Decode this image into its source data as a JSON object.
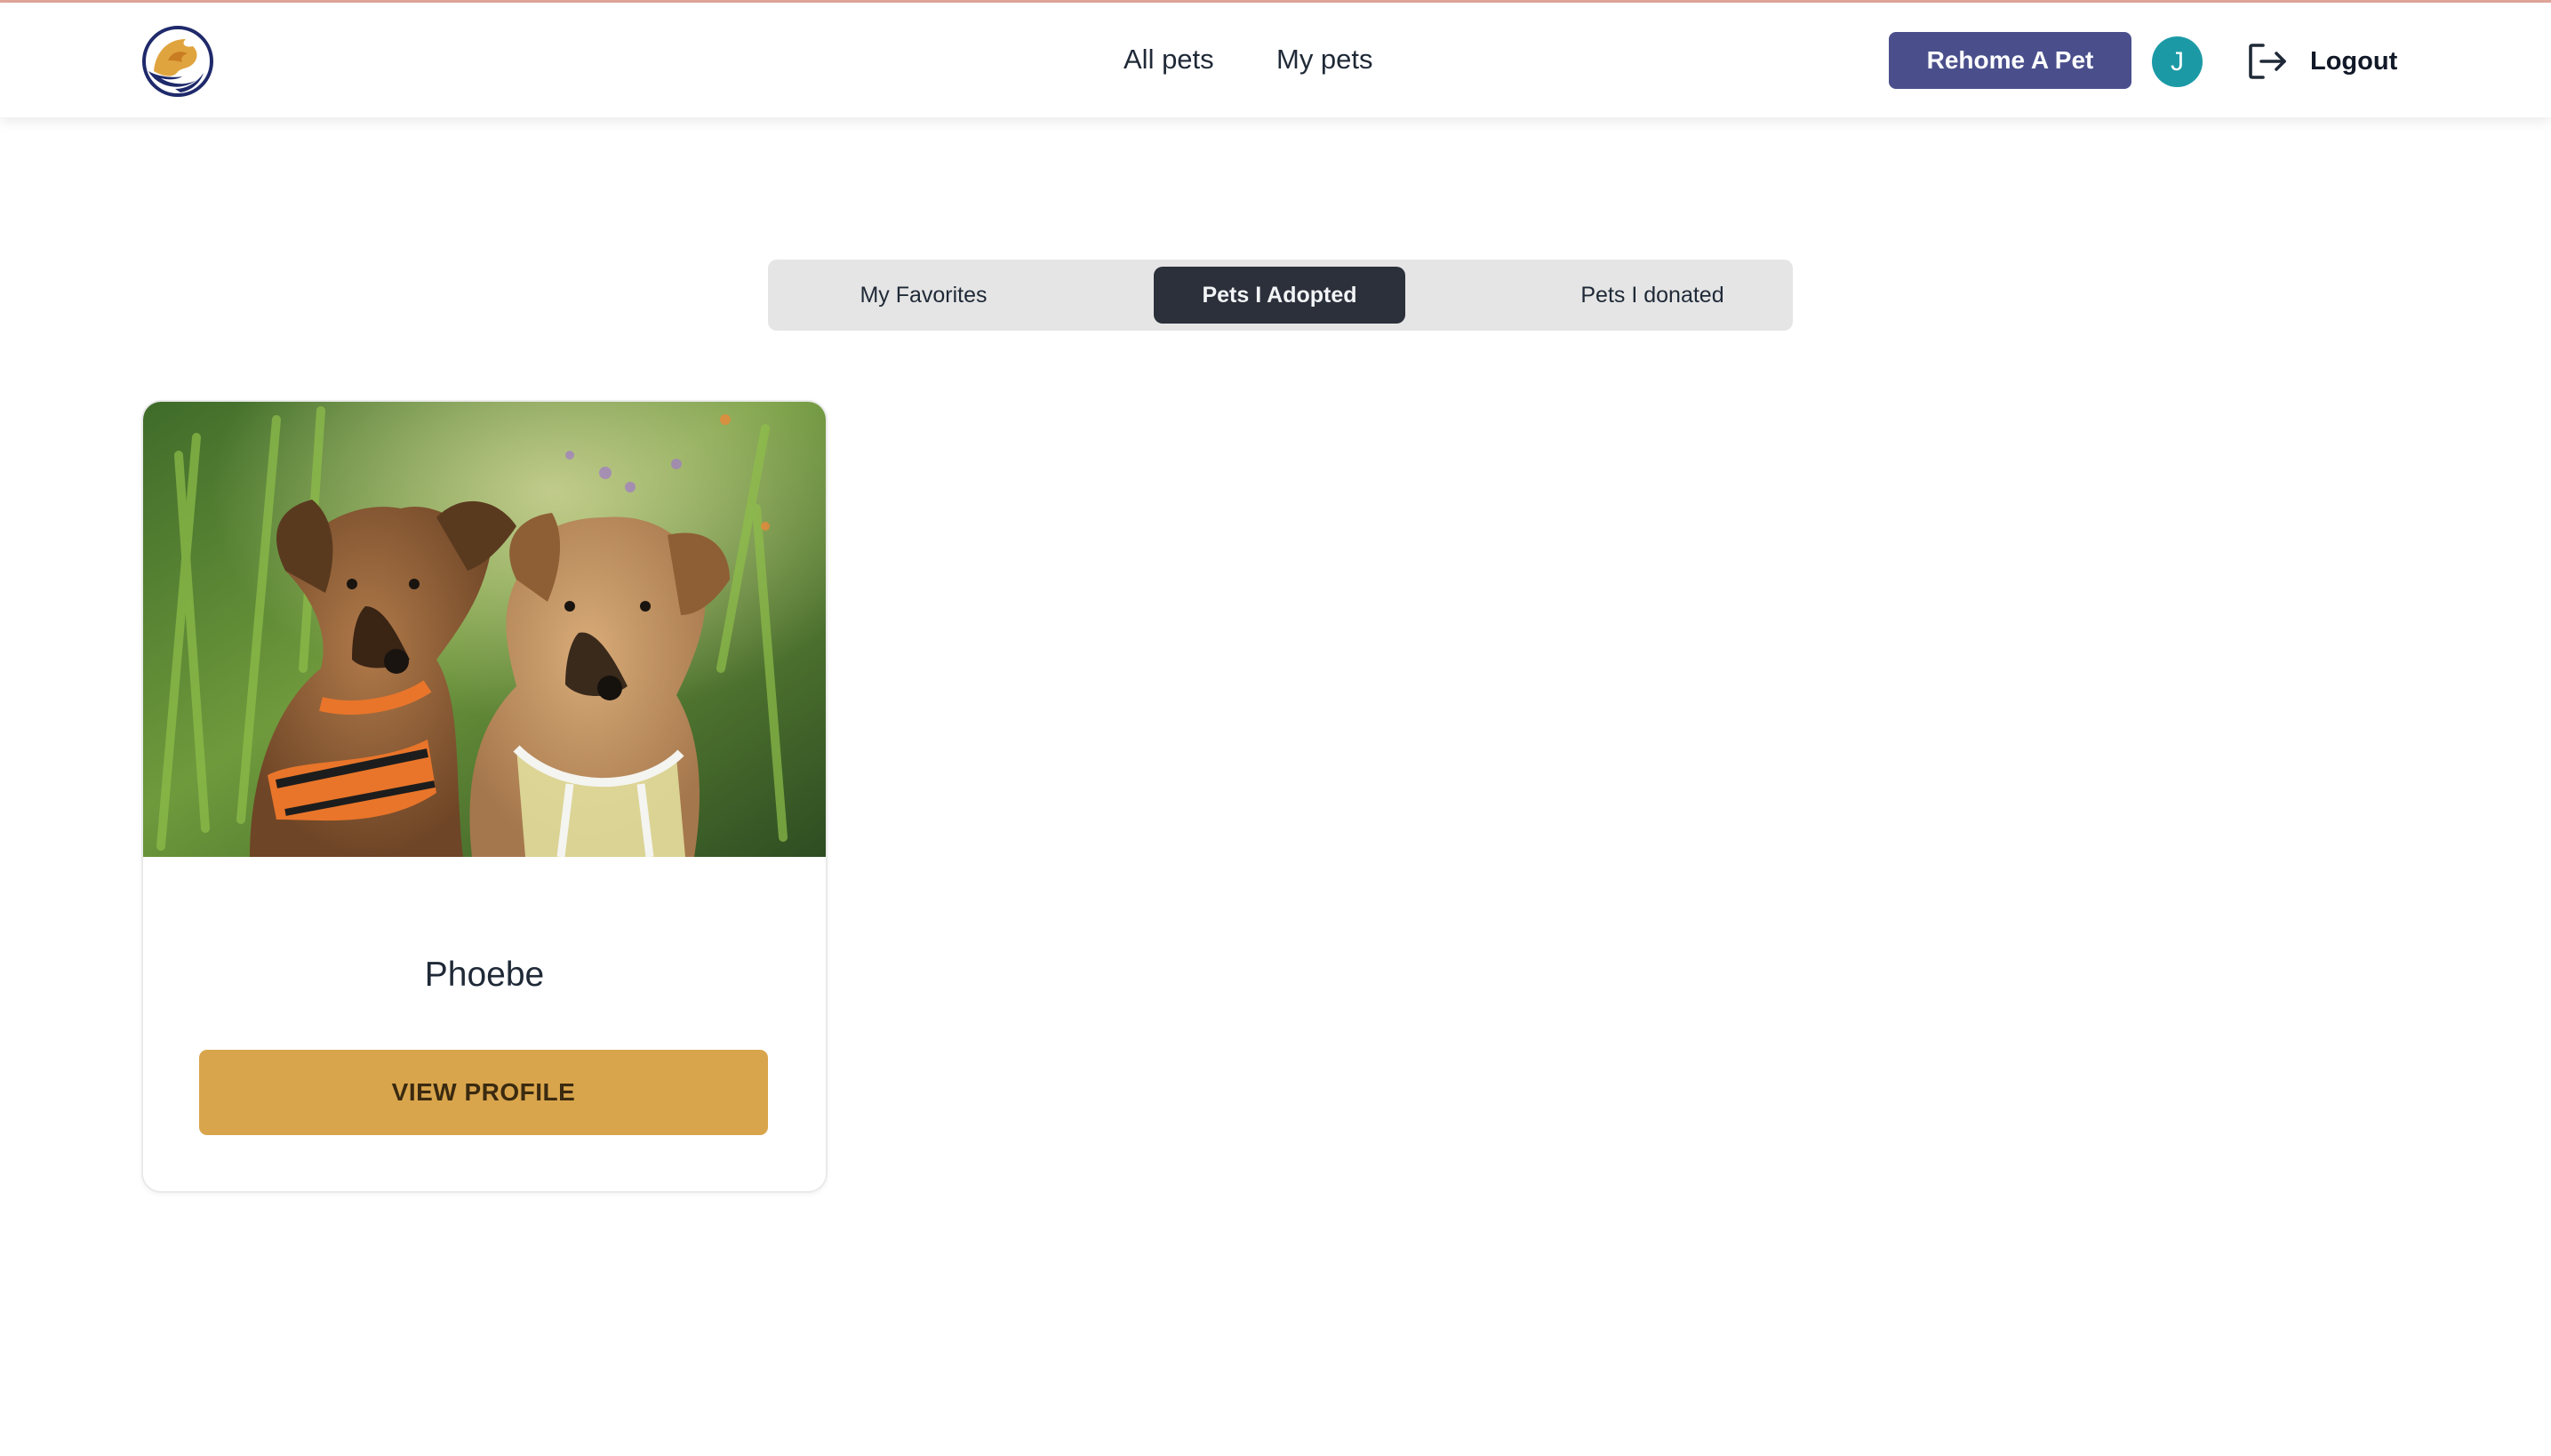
{
  "header": {
    "logo_icon": "pet-rescue-logo-icon",
    "nav": [
      {
        "label": "All pets"
      },
      {
        "label": "My pets"
      }
    ],
    "rehome_label": "Rehome A Pet",
    "avatar_initial": "J",
    "logout_icon": "logout-icon",
    "logout_label": "Logout"
  },
  "tabs": [
    {
      "label": "My Favorites",
      "active": false
    },
    {
      "label": "Pets I Adopted",
      "active": true
    },
    {
      "label": "Pets I donated",
      "active": false
    }
  ],
  "pets": [
    {
      "name": "Phoebe",
      "image_icon": "two-dogs-photo",
      "action_label": "VIEW PROFILE"
    }
  ],
  "colors": {
    "primary": "#4a4f8c",
    "accent": "#d9a54c",
    "avatar": "#1b9aa6",
    "active_tab": "#2b303b"
  }
}
